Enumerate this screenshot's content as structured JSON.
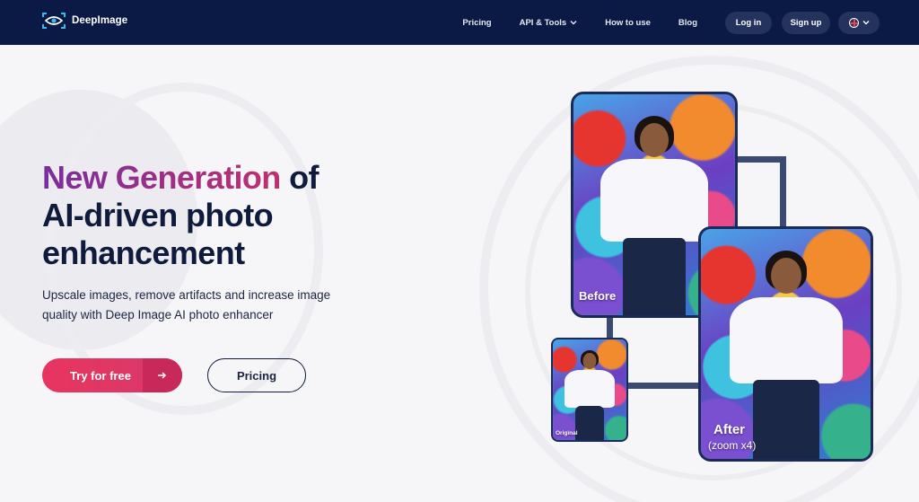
{
  "brand": {
    "name": "DeepImage",
    "logo_icon": "eye-scan-icon"
  },
  "nav": {
    "links": [
      {
        "label": "Pricing"
      },
      {
        "label": "API & Tools",
        "has_dropdown": true
      },
      {
        "label": "How to use"
      },
      {
        "label": "Blog"
      }
    ],
    "login_label": "Log in",
    "signup_label": "Sign up",
    "language_icon": "uk-flag-icon"
  },
  "hero": {
    "title_highlight": "New Generation",
    "title_rest_1": " of",
    "title_line_2": "AI-driven photo",
    "title_line_3": "enhancement",
    "subtitle": "Upscale images, remove artifacts and increase image quality with Deep Image AI photo enhancer",
    "cta_primary": "Try for free",
    "cta_primary_icon": "arrow-right-icon",
    "cta_secondary": "Pricing"
  },
  "showcase": {
    "before_label": "Before",
    "after_label": "After",
    "after_zoom": "(zoom x4)",
    "original_label": "Original"
  },
  "colors": {
    "nav_bg": "#0b1a45",
    "accent_pink": "#e8345f",
    "gradient_purple": "#7a2d9e",
    "text_dark": "#0f1b3d"
  }
}
